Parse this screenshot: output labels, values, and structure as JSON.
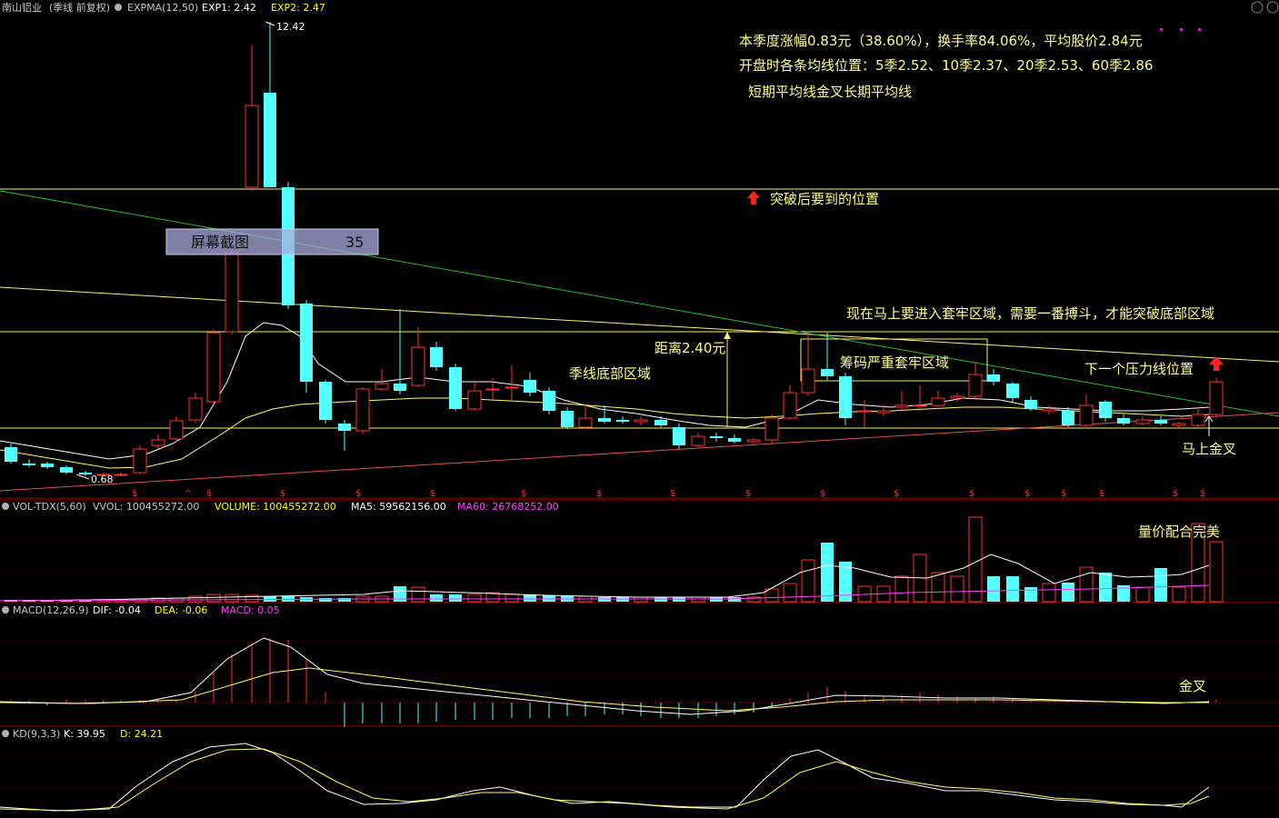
{
  "header": {
    "stock": "南山铝业",
    "mode": "(季线 前复权)",
    "expma": "EXPMA(12,50)",
    "exp1": "EXP1: 2.42",
    "exp2": "EXP2: 2.47"
  },
  "price_labels": {
    "high": "12.42",
    "low": "0.68"
  },
  "annotations": {
    "info1": "本季度涨幅0.83元（38.60%），换手率84.06%，平均股价2.84元",
    "info2": "开盘时各条均线位置：5季2.52、10季2.37、20季2.53、60季2.86",
    "info3": "短期平均线金叉长期平均线",
    "breakout": "突破后要到的位置",
    "enter": "现在马上要进入套牢区域，需要一番搏斗，才能突破底部区域",
    "distance": "距离2.40元",
    "bottom_zone": "季线底部区域",
    "trap_zone": "筹码严重套牢区域",
    "next_pressure": "下一个压力线位置",
    "golden_cross": "马上金叉",
    "vol_note": "量价配合完美",
    "macd_note": "金叉"
  },
  "overlay": {
    "label": "屏幕截图",
    "value": "35"
  },
  "vol_header": {
    "name": "VOL-TDX(5,60)",
    "vvol": "VVOL: 100455272.00",
    "volume": "VOLUME: 100455272.00",
    "ma5": "MA5: 59562156.00",
    "ma60": "MA60: 26768252.00"
  },
  "macd_header": {
    "name": "MACD(12,26,9)",
    "dif": "DIF: -0.04",
    "dea": "DEA: -0.06",
    "macd": "MACD: 0.05"
  },
  "kd_header": {
    "name": "KD(9,3,3)",
    "k": "K: 39.95",
    "d": "D: 24.21"
  },
  "colors": {
    "up": "#ff3232",
    "down": "#54ffff",
    "yellow": "#ffff00",
    "green": "#00c800",
    "magenta": "#ff00ff",
    "text": "#ffff8a"
  }
}
